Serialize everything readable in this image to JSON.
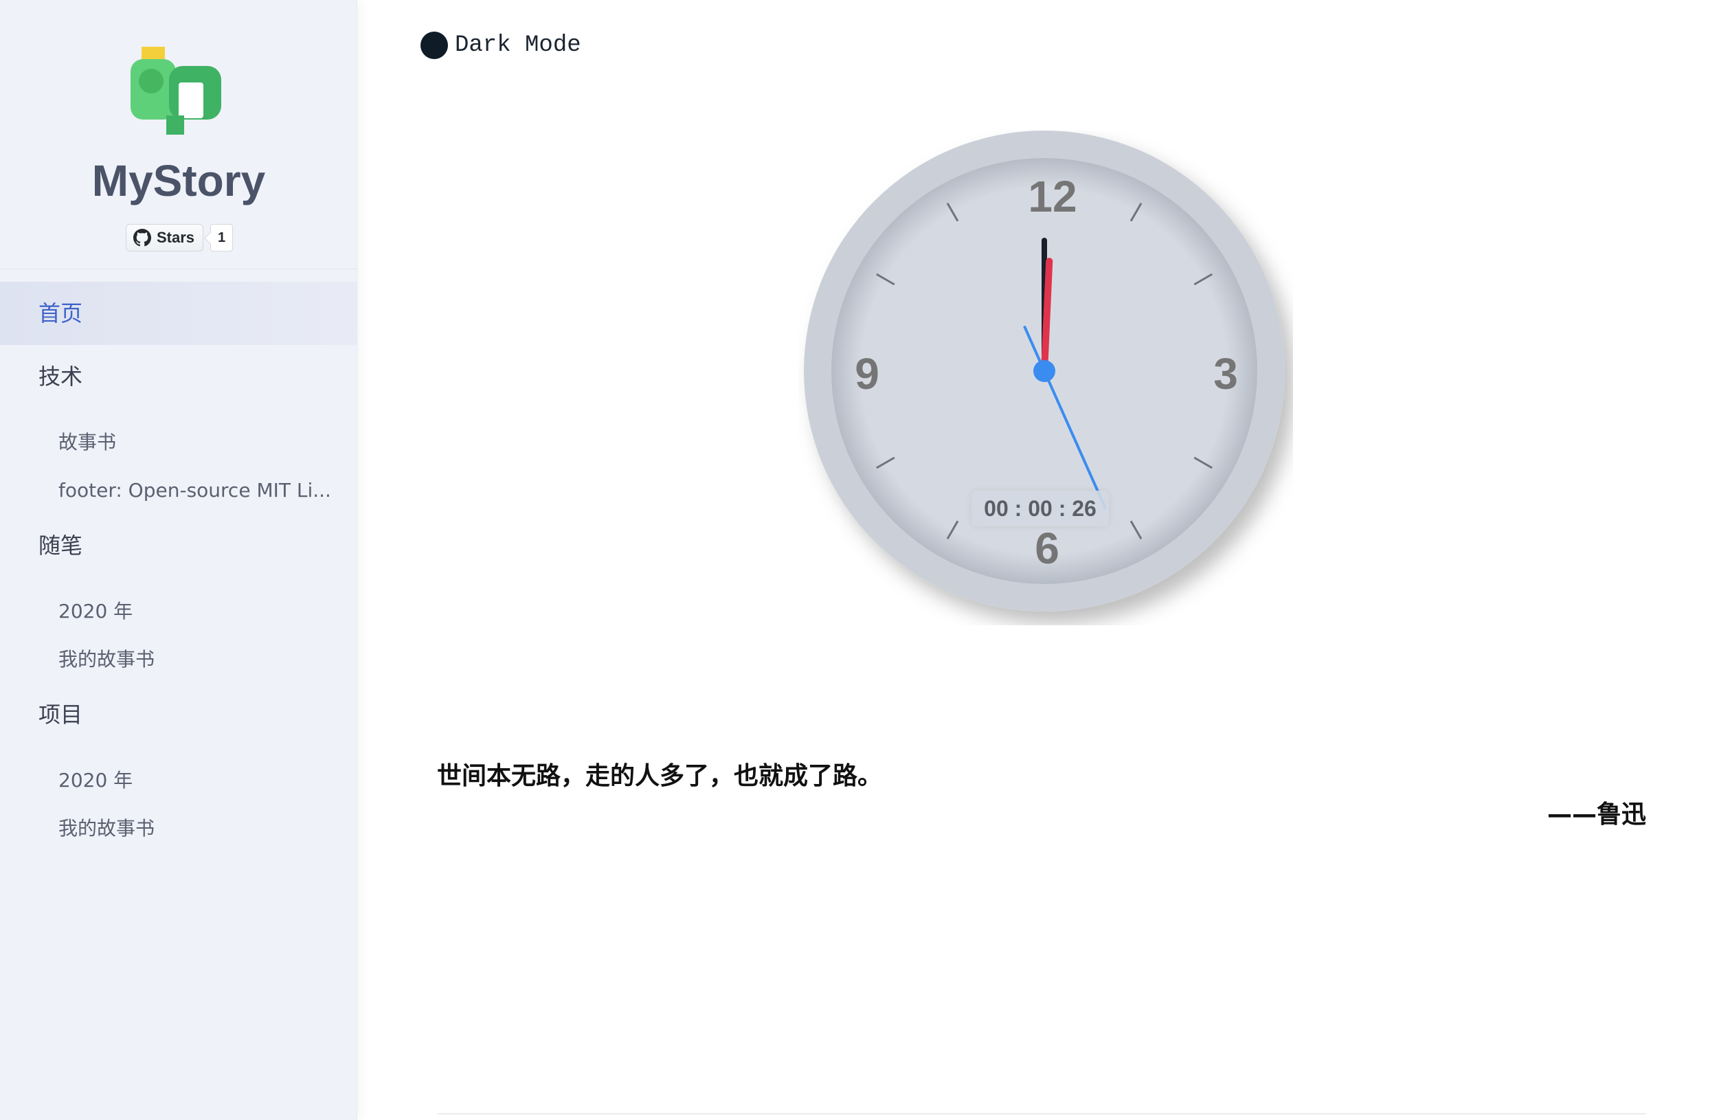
{
  "brand": {
    "title": "MyStory",
    "github_badge": {
      "label": "Stars",
      "count": "1"
    },
    "logo_icon": "mailbox-logo"
  },
  "sidebar": {
    "items": [
      {
        "label": "首页",
        "active": true,
        "level": 1
      },
      {
        "label": "技术",
        "level": 1
      },
      {
        "label": "故事书",
        "level": 2
      },
      {
        "label": "footer: Open-source MIT Li...",
        "level": 2
      },
      {
        "label": "随笔",
        "level": 1
      },
      {
        "label": "2020 年",
        "level": 2
      },
      {
        "label": "我的故事书",
        "level": 2
      },
      {
        "label": "项目",
        "level": 1
      },
      {
        "label": "2020 年",
        "level": 2
      },
      {
        "label": "我的故事书",
        "level": 2
      }
    ]
  },
  "toggle": {
    "label": "Dark Mode",
    "icon": "moon-dot-icon"
  },
  "clock": {
    "numerals": [
      "12",
      "3",
      "6",
      "9"
    ],
    "digital_time": "00 : 00 : 26",
    "hour": 0,
    "minute": 0,
    "second": 26
  },
  "quote": {
    "text": "世间本无路，走的人多了，也就成了路。",
    "author": "——鲁迅"
  },
  "colors": {
    "accent": "#3e63c9",
    "second_hand": "#3b8cf0",
    "minute_hand": "#e0344d",
    "hour_hand": "#1a1f2c",
    "sidebar_bg": "#f0f2f9"
  }
}
